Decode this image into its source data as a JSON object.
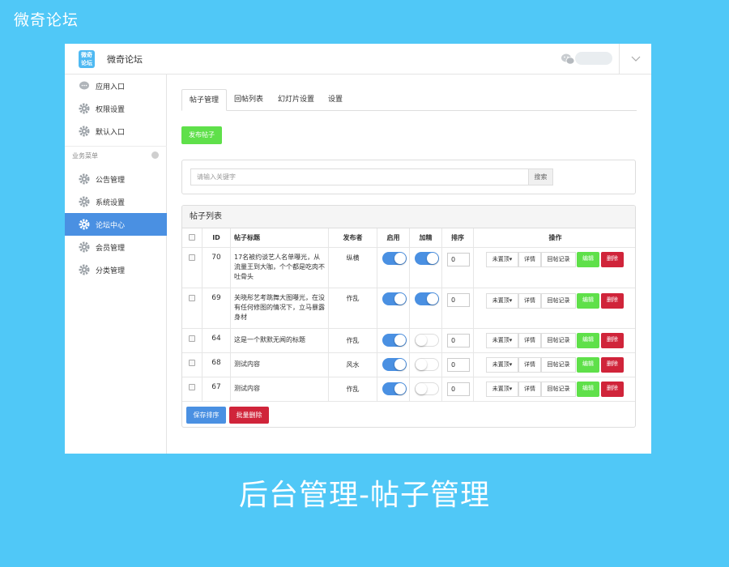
{
  "brand": "微奇论坛",
  "caption": "后台管理-帖子管理",
  "topbar": {
    "logo_line1": "微奇",
    "logo_line2": "论坛",
    "title": "微奇论坛"
  },
  "sidebar": {
    "items_top": [
      {
        "label": "应用入口",
        "icon": "chat-bubble-icon"
      },
      {
        "label": "权限设置",
        "icon": "gear-icon"
      },
      {
        "label": "默认入口",
        "icon": "gear-icon"
      }
    ],
    "section_label": "业务菜单",
    "items_business": [
      {
        "label": "公告管理",
        "icon": "gear-icon"
      },
      {
        "label": "系统设置",
        "icon": "gear-icon"
      },
      {
        "label": "论坛中心",
        "icon": "gear-icon",
        "active": true
      },
      {
        "label": "会员管理",
        "icon": "gear-icon"
      },
      {
        "label": "分类管理",
        "icon": "gear-icon"
      }
    ]
  },
  "tabs": [
    {
      "label": "帖子管理",
      "active": true
    },
    {
      "label": "回帖列表"
    },
    {
      "label": "幻灯片设置"
    },
    {
      "label": "设置"
    }
  ],
  "publish_label": "发布帖子",
  "search": {
    "placeholder": "请输入关键字",
    "button": "搜索"
  },
  "list": {
    "title": "帖子列表",
    "columns": [
      "ID",
      "帖子标题",
      "发布者",
      "启用",
      "加精",
      "排序",
      "操作"
    ],
    "rows": [
      {
        "id": "70",
        "title": "17名被约谈艺人名单曝光，从流量王到大咖，个个都是吃肉不吐骨头",
        "author": "纵横",
        "enabled": true,
        "featured": true,
        "order": "0"
      },
      {
        "id": "69",
        "title": "关晓彤艺考跳舞大图曝光，在没有任何修图的情况下，立马暴露身材",
        "author": "作乱",
        "enabled": true,
        "featured": true,
        "order": "0"
      },
      {
        "id": "64",
        "title": "这是一个默默无闻的标题",
        "author": "作乱",
        "enabled": true,
        "featured": false,
        "order": "0"
      },
      {
        "id": "68",
        "title": "测试内容",
        "author": "风水",
        "enabled": true,
        "featured": false,
        "order": "0"
      },
      {
        "id": "67",
        "title": "测试内容",
        "author": "作乱",
        "enabled": true,
        "featured": false,
        "order": "0"
      }
    ],
    "ops": {
      "pin": "未置顶▾",
      "detail": "详情",
      "replies": "回帖记录",
      "edit": "编辑",
      "delete": "删除"
    },
    "save_order": "保存排序",
    "batch_delete": "批量删除"
  },
  "colors": {
    "background": "#50c8f7",
    "primary": "#4a90e2",
    "success": "#5fe04a",
    "danger": "#d0243a"
  }
}
